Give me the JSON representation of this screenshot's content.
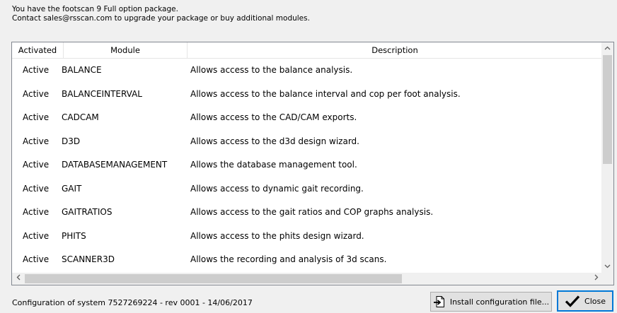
{
  "info": {
    "line1": "You have the footscan 9 Full option package.",
    "line2": "Contact sales@rsscan.com to upgrade your package or buy additional modules."
  },
  "table": {
    "columns": [
      "Activated",
      "Module",
      "Description"
    ],
    "rows": [
      {
        "status": "Active",
        "module": "BALANCE",
        "description": "Allows access to the balance analysis."
      },
      {
        "status": "Active",
        "module": "BALANCEINTERVAL",
        "description": "Allows access to the balance interval and cop per foot analysis."
      },
      {
        "status": "Active",
        "module": "CADCAM",
        "description": "Allows access to the CAD/CAM exports."
      },
      {
        "status": "Active",
        "module": "D3D",
        "description": "Allows access to the d3d design wizard."
      },
      {
        "status": "Active",
        "module": "DATABASEMANAGEMENT",
        "description": "Allows the database management tool."
      },
      {
        "status": "Active",
        "module": "GAIT",
        "description": "Allows access to dynamic gait recording."
      },
      {
        "status": "Active",
        "module": "GAITRATIOS",
        "description": "Allows access to the gait ratios and COP graphs analysis."
      },
      {
        "status": "Active",
        "module": "PHITS",
        "description": "Allows access to the phits design wizard."
      },
      {
        "status": "Active",
        "module": "SCANNER3D",
        "description": "Allows the recording and analysis of 3d scans."
      }
    ]
  },
  "footer": {
    "config_text": "Configuration of system 7527269224 - rev 0001 - 14/06/2017",
    "install_label": "Install configuration file...",
    "close_label": "Close"
  },
  "icons": {
    "install": "import-file-icon",
    "close": "checkmark-icon",
    "scroll_up": "chevron-up-icon",
    "scroll_down": "chevron-down-icon",
    "scroll_left": "chevron-left-icon",
    "scroll_right": "chevron-right-icon"
  },
  "colors": {
    "close_border": "#0078d7",
    "table_border": "#828790"
  }
}
